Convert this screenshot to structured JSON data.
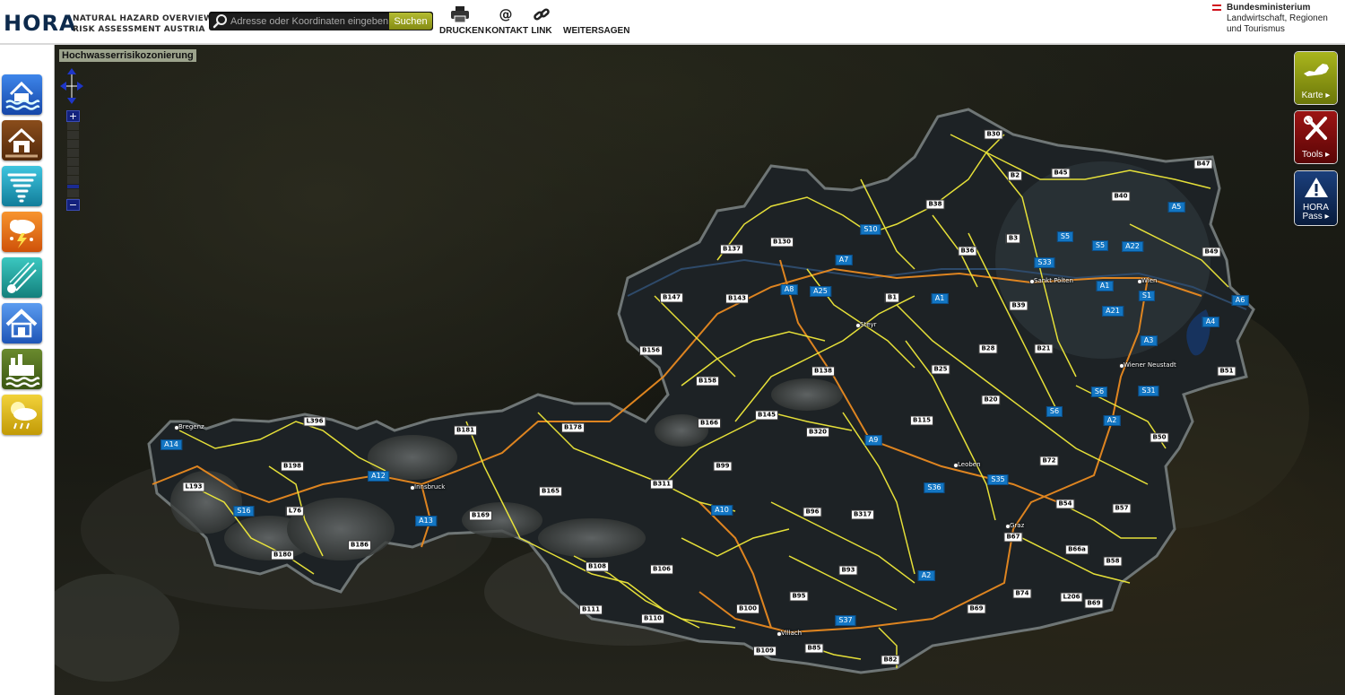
{
  "header": {
    "logo": "HORA",
    "logo_sub_line1": "NATURAL HAZARD OVERVIEW &",
    "logo_sub_line2": "RISK ASSESSMENT AUSTRIA",
    "search": {
      "placeholder": "Adresse oder Koordinaten eingeben",
      "value": "",
      "button_label": "Suchen"
    },
    "actions": [
      {
        "label": "DRUCKEN",
        "icon": "printer-icon"
      },
      {
        "label": "KONTAKT",
        "icon": "at-sign-icon"
      },
      {
        "label": "LINK",
        "icon": "link-chain-icon"
      },
      {
        "label": "WEITERSAGEN",
        "icon": "share-icon"
      }
    ],
    "ministry": {
      "line1": "Bundesministerium",
      "line2": "Landwirtschaft, Regionen",
      "line3": "und Tourismus"
    }
  },
  "sidebar": {
    "hazards": [
      {
        "name": "flood",
        "icon": "flood-house-icon",
        "color": "#1f5fc8"
      },
      {
        "name": "surface-runoff",
        "icon": "torrent-house-icon",
        "color": "#6b3a12"
      },
      {
        "name": "storm",
        "icon": "tornado-icon",
        "color": "#1d9bb5"
      },
      {
        "name": "hail",
        "icon": "thunderstorm-icon",
        "color": "#e8711a"
      },
      {
        "name": "earthquake",
        "icon": "meteor-icon",
        "color": "#23a3a0"
      },
      {
        "name": "snow-load",
        "icon": "snow-house-icon",
        "color": "#2f6fcf"
      },
      {
        "name": "flash-flood",
        "icon": "industry-water-icon",
        "color": "#4f6b22"
      },
      {
        "name": "climate",
        "icon": "sun-cloud-rain-icon",
        "color": "#d9b10e"
      }
    ]
  },
  "map": {
    "layer_title": "Hochwasserrisikozonierung",
    "zoom_in_label": "+",
    "zoom_out_label": "−",
    "zoom_level_step": 7,
    "zoom_steps": 10,
    "right_panel": [
      {
        "label": "Karte",
        "arrow": "▸",
        "icon": "austria-map-icon",
        "color": "#7d8a12"
      },
      {
        "label": "Tools",
        "arrow": "▸",
        "icon": "tools-icon",
        "color": "#7a0c0c"
      },
      {
        "label_line1": "HORA",
        "label_line2": "Pass",
        "arrow": "▸",
        "icon": "warning-icon",
        "color": "#0e2a56"
      }
    ],
    "road_labels": [
      "B30",
      "B47",
      "B2",
      "B45",
      "B40",
      "A5",
      "B38",
      "S10",
      "S5",
      "S5",
      "A22",
      "B130",
      "B137",
      "B3",
      "B36",
      "B49",
      "A7",
      "S33",
      "A8",
      "A25",
      "B1",
      "A1",
      "A1",
      "B147",
      "B143",
      "B39",
      "S1",
      "A6",
      "A21",
      "B156",
      "B28",
      "B21",
      "A3",
      "A4",
      "B138",
      "B25",
      "B158",
      "B51",
      "S6",
      "S31",
      "B20",
      "B166",
      "B145",
      "B115",
      "S6",
      "A2",
      "B181",
      "B178",
      "L396",
      "B320",
      "A9",
      "B50",
      "A14",
      "B198",
      "A12",
      "B99",
      "B72",
      "L193",
      "B311",
      "S35",
      "S16",
      "L76",
      "B165",
      "S36",
      "A13",
      "B169",
      "A10",
      "B96",
      "B317",
      "B54",
      "B57",
      "B186",
      "B180",
      "B67",
      "B66a",
      "B108",
      "B106",
      "B93",
      "B58",
      "A2",
      "B95",
      "B74",
      "L206",
      "B111",
      "B100",
      "B69",
      "B69",
      "B110",
      "S37",
      "B85",
      "B109",
      "B82"
    ],
    "city_labels": [
      "Wien",
      "Sankt Pölten",
      "Steyr",
      "Wiener Neustadt",
      "Bregenz",
      "Innsbruck",
      "Leoben",
      "Graz",
      "Villach"
    ]
  }
}
